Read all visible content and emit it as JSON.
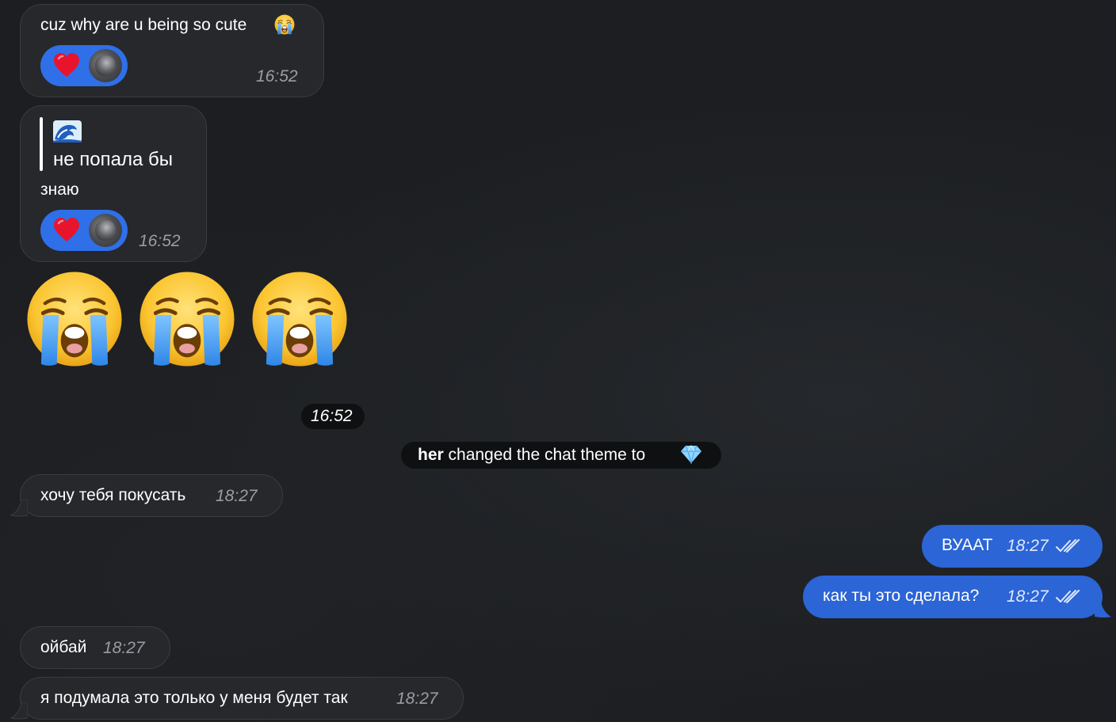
{
  "messages": [
    {
      "text": "cuz why are u being so cute",
      "time": "16:52"
    },
    {
      "quote_icon": "wave-emoji",
      "quote_text": "не попала бы",
      "text": "знаю",
      "time": "16:52"
    },
    {
      "sticker": [
        "loudly-crying-face-emoji",
        "loudly-crying-face-emoji",
        "loudly-crying-face-emoji"
      ],
      "time": "16:52"
    },
    {
      "text": "хочу тебя покусать",
      "time": "18:27"
    },
    {
      "text": "ВУААТ",
      "time": "18:27"
    },
    {
      "text": "как ты это сделала?",
      "time": "18:27"
    },
    {
      "text": "ойбай",
      "time": "18:27"
    },
    {
      "text": "я подумала это только у меня будет так",
      "time": "18:27"
    }
  ],
  "service": {
    "actor": "her",
    "text": " changed the chat theme to ",
    "theme_icon": "diamond-emoji"
  },
  "reaction": {
    "icon": "red-heart-emoji"
  },
  "colors": {
    "background": "#1c1e21",
    "incoming_bubble": "#26282c",
    "outgoing_bubble": "#2b65d6",
    "reaction_pill": "#2f6fe8",
    "service_pill": "#0f1012"
  }
}
